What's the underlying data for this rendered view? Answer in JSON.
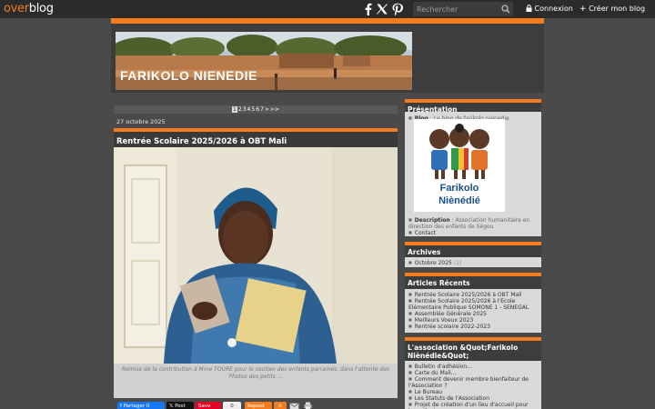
{
  "topbar": {
    "logo_over": "over",
    "logo_blog": "blog",
    "search_placeholder": "Rechercher",
    "login_label": "Connexion",
    "create_label": "Créer mon blog"
  },
  "header": {
    "title": "FARIKOLO NIENEDIE"
  },
  "pager": {
    "current": "1",
    "pages": [
      "2",
      "3",
      "4",
      "5",
      "6",
      "7"
    ],
    "next": ">",
    "last": ">>"
  },
  "post": {
    "date": "27 octobre 2025",
    "title": "Rentrée Scolaire 2025/2026 à OBT Mali",
    "caption": "Remise de la contribution à Mme TOURE pour le soutien des enfants parrainés, dans l'attente des Photos des petits ...",
    "share": {
      "facebook": "Partager",
      "facebook_count": "0",
      "x": "Post",
      "pinterest": "Save",
      "pinterest_count": "0",
      "repost": "Repost",
      "repost_count": "0"
    }
  },
  "sidebar": {
    "presentation": {
      "title": "Présentation",
      "blog_key": "Blog",
      "blog_val": ": Le blog de farikolo nienedie",
      "avatar_line1": "Farikolo",
      "avatar_line2": "Nièné​dié",
      "desc_key": "Description",
      "desc_val": ": Association humanitaire en direction des enfants de Ségou",
      "contact": "Contact"
    },
    "archives": {
      "title": "Archives",
      "items": [
        {
          "label": "Octobre 2025",
          "count": "(1)"
        }
      ]
    },
    "recent": {
      "title": "Articles Récents",
      "items": [
        "Rentrée Scolaire 2025/2026 à OBT Mali",
        "Rentrée Scolaire 2025/2026 à l'Ecole Elémentaire Publique SOMONE 1 - SENEGAL",
        "Assemblée Générale 2025",
        "Meilleurs Voeux 2023",
        "Rentrée scolaire 2022-2023"
      ]
    },
    "association": {
      "title": "L'association &Quot;Farikolo Niènédie&Quot;",
      "items": [
        "Bulletin d'adhésion...",
        "Carte du Mali...",
        "Comment devenir membre bienfaiteur de l'Association ?",
        "Le Bureau",
        "Les Statuts de l'Association",
        "Projet de création d'un lieu d'accueil pour les enfants"
      ]
    }
  },
  "colors": {
    "accent": "#f47c20",
    "background": "#4a4a4a",
    "topbar": "#2b2b2b"
  }
}
